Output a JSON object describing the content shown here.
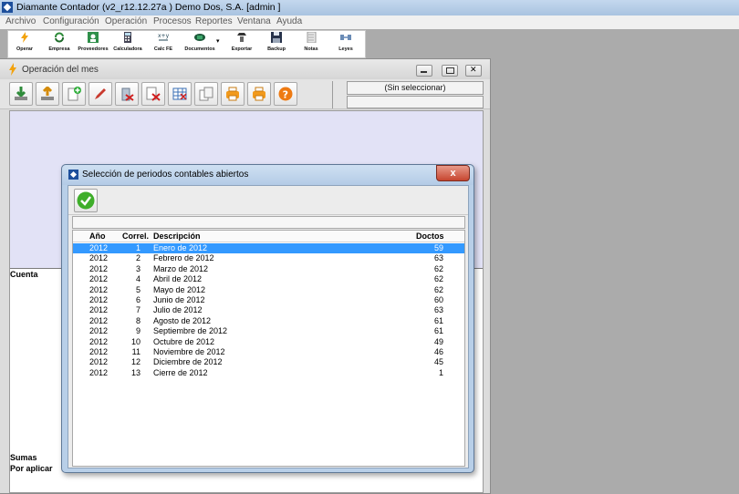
{
  "app": {
    "title": "Diamante Contador (v2_r12.12.27a ) Demo Dos, S.A.  [admin ]"
  },
  "menu": [
    "Archivo",
    "Configuración",
    "Operación",
    "Procesos",
    "Reportes",
    "Ventana",
    "Ayuda"
  ],
  "toolbar": [
    {
      "label": "Operar",
      "icon": "lightning-icon"
    },
    {
      "label": "Empresa",
      "icon": "refresh-icon"
    },
    {
      "label": "Proveedores",
      "icon": "people-icon"
    },
    {
      "label": "Calculadora",
      "icon": "calculator-icon"
    },
    {
      "label": "Calc FE",
      "icon": "formula-icon"
    },
    {
      "label": "Documentos",
      "icon": "documents-icon"
    },
    {
      "label": "Exportar",
      "icon": "export-icon"
    },
    {
      "label": "Backup",
      "icon": "floppy-icon"
    },
    {
      "label": "Notas",
      "icon": "notes-icon"
    },
    {
      "label": "Leyes",
      "icon": "law-icon"
    }
  ],
  "child": {
    "title": "Operación del mes",
    "selector_value": "(Sin seleccionar)",
    "cuenta_label": "Cuenta",
    "sumas_label": "Sumas",
    "por_aplicar_label": "Por aplicar"
  },
  "dialog": {
    "title": "Selección de periodos contables abiertos",
    "close_label": "x",
    "columns": {
      "year": "Año",
      "corr": "Correl.",
      "desc": "Descripción",
      "doc": "Doctos"
    },
    "rows": [
      {
        "year": "2012",
        "corr": "1",
        "desc": "Enero de 2012",
        "doc": "59",
        "selected": true
      },
      {
        "year": "2012",
        "corr": "2",
        "desc": "Febrero de 2012",
        "doc": "63"
      },
      {
        "year": "2012",
        "corr": "3",
        "desc": "Marzo de 2012",
        "doc": "62"
      },
      {
        "year": "2012",
        "corr": "4",
        "desc": "Abril de 2012",
        "doc": "62"
      },
      {
        "year": "2012",
        "corr": "5",
        "desc": "Mayo de 2012",
        "doc": "62"
      },
      {
        "year": "2012",
        "corr": "6",
        "desc": "Junio de 2012",
        "doc": "60"
      },
      {
        "year": "2012",
        "corr": "7",
        "desc": "Julio de 2012",
        "doc": "63"
      },
      {
        "year": "2012",
        "corr": "8",
        "desc": "Agosto de 2012",
        "doc": "61"
      },
      {
        "year": "2012",
        "corr": "9",
        "desc": "Septiembre de 2012",
        "doc": "61"
      },
      {
        "year": "2012",
        "corr": "10",
        "desc": "Octubre de 2012",
        "doc": "49"
      },
      {
        "year": "2012",
        "corr": "11",
        "desc": "Noviembre de 2012",
        "doc": "46"
      },
      {
        "year": "2012",
        "corr": "12",
        "desc": "Diciembre de 2012",
        "doc": "45"
      },
      {
        "year": "2012",
        "corr": "13",
        "desc": "Cierre de 2012",
        "doc": "1"
      }
    ]
  },
  "colors": {
    "selection": "#3399ff",
    "workarea": "#e2e2f6",
    "desktop": "#ababab",
    "accent": "#1d4f9c"
  }
}
